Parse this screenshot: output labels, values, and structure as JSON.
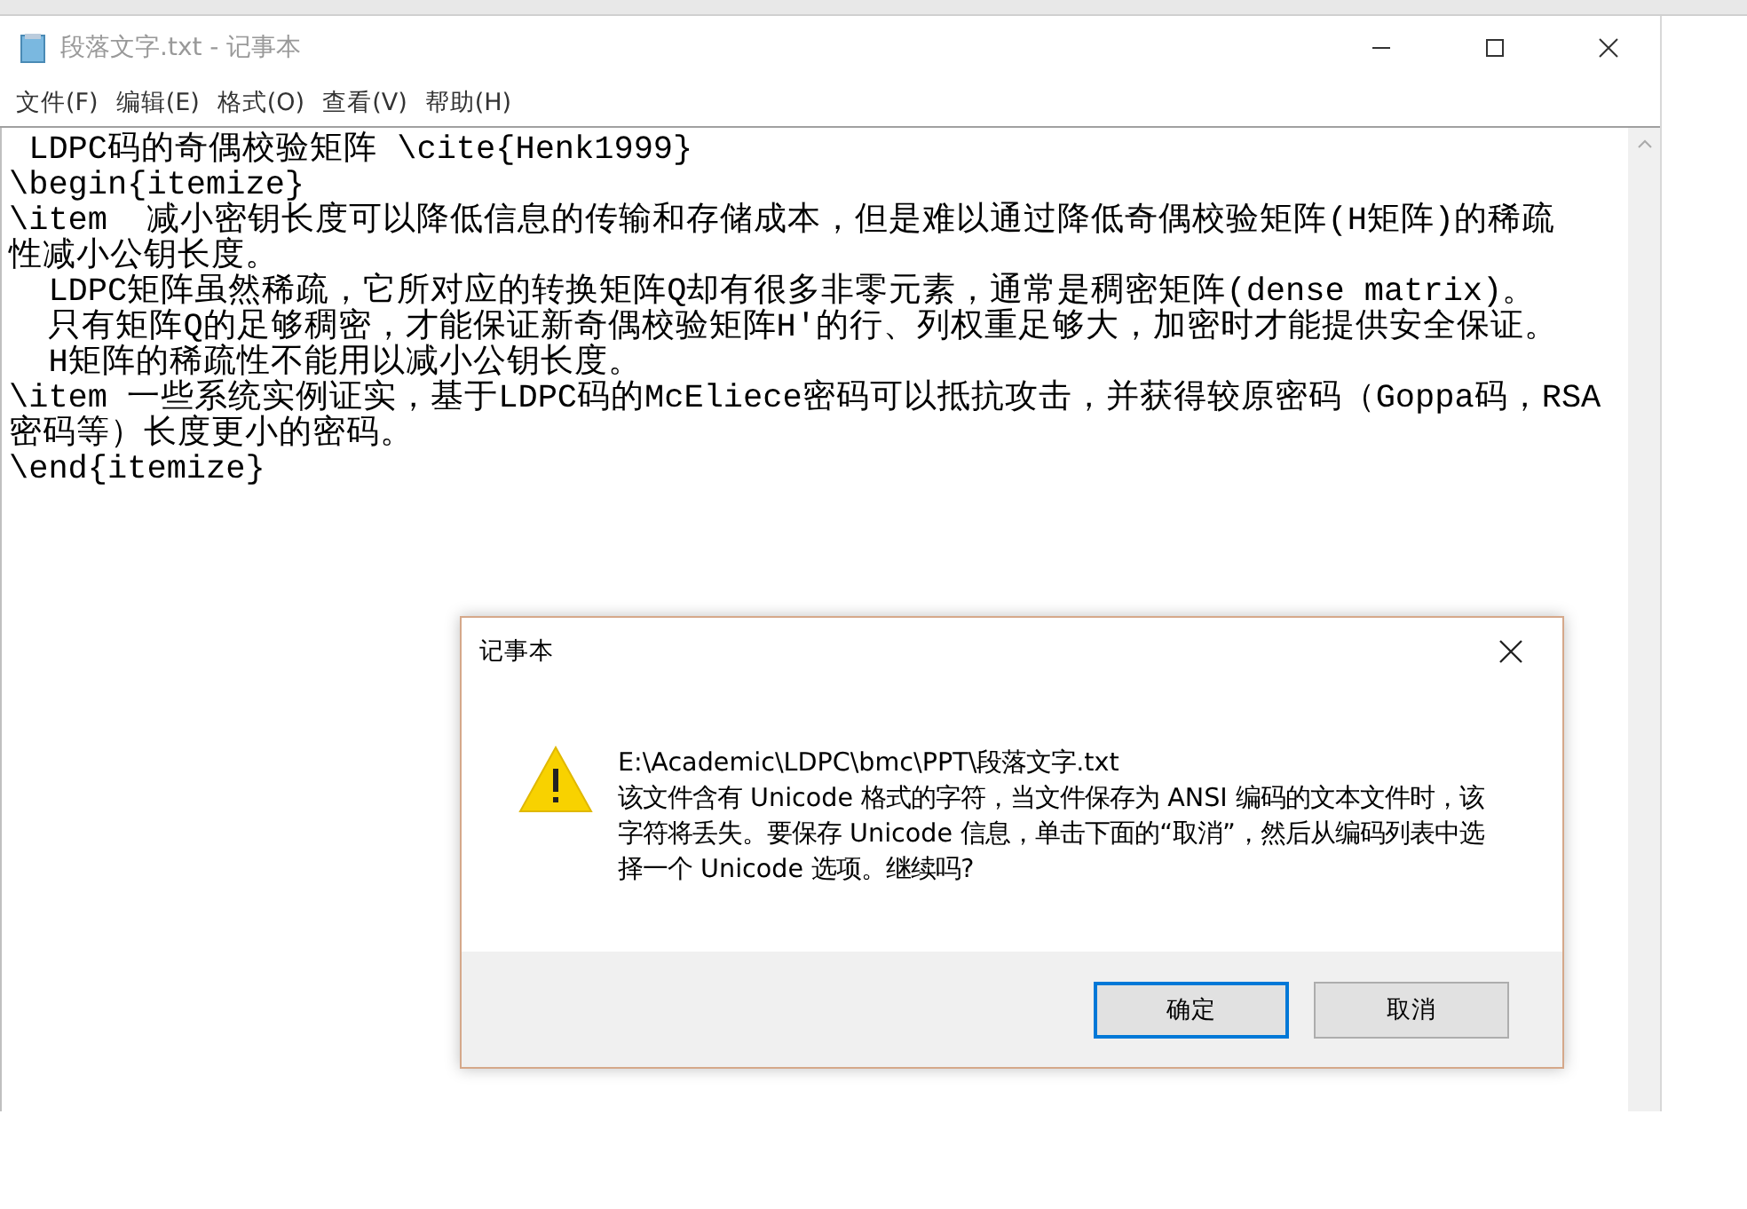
{
  "window": {
    "title": "段落文字.txt - 记事本"
  },
  "menu": [
    {
      "label": "文件(F)"
    },
    {
      "label": "编辑(E)"
    },
    {
      "label": "格式(O)"
    },
    {
      "label": "查看(V)"
    },
    {
      "label": "帮助(H)"
    }
  ],
  "editor": {
    "lines": [
      " LDPC码的奇偶校验矩阵 \\cite{Henk1999}",
      "\\begin{itemize}",
      "\\item  减小密钥长度可以降低信息的传输和存储成本，但是难以通过降低奇偶校验矩阵(H矩阵)的稀疏",
      "性减小公钥长度。",
      "  LDPC矩阵虽然稀疏，它所对应的转换矩阵Q却有很多非零元素，通常是稠密矩阵(dense matrix)。",
      "  只有矩阵Q的足够稠密，才能保证新奇偶校验矩阵H′的行、列权重足够大，加密时才能提供安全保证。",
      "  H矩阵的稀疏性不能用以减小公钥长度。",
      "\\item 一些系统实例证实，基于LDPC码的McEliece密码可以抵抗攻击，并获得较原密码（Goppa码，RSA",
      "密码等）长度更小的密码。",
      "\\end{itemize}"
    ]
  },
  "dialog": {
    "title": "记事本",
    "path": "E:\\Academic\\LDPC\\bmc\\PPT\\段落文字.txt",
    "message": "该文件含有 Unicode 格式的字符，当文件保存为 ANSI 编码的文本文件时，该字符将丢失。要保存 Unicode 信息，单击下面的“取消”，然后从编码列表中选择一个 Unicode 选项。继续吗?",
    "buttons": [
      {
        "label": "确定",
        "focused": true
      },
      {
        "label": "取消",
        "focused": false
      }
    ]
  }
}
